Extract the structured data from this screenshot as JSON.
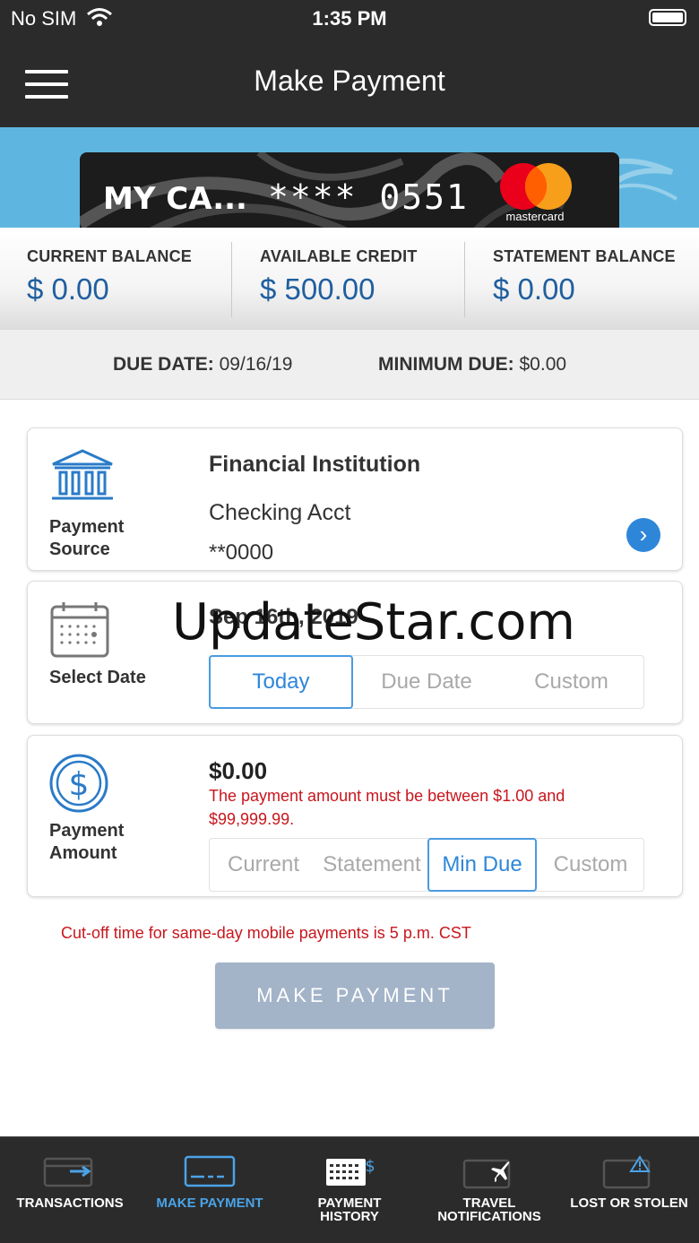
{
  "status_bar": {
    "carrier": "No SIM",
    "time": "1:35 PM",
    "battery_level": 1.0
  },
  "header": {
    "title": "Make Payment"
  },
  "card": {
    "name": "MY CA...",
    "masked_number": "**** 0551",
    "network": "mastercard",
    "brand_colors": {
      "red": "#eb001b",
      "orange": "#f79e1b"
    }
  },
  "balances": [
    {
      "label": "CURRENT BALANCE",
      "value": "$ 0.00"
    },
    {
      "label": "AVAILABLE CREDIT",
      "value": "$ 500.00"
    },
    {
      "label": "STATEMENT BALANCE",
      "value": "$ 0.00"
    }
  ],
  "due": {
    "due_date_label": "DUE DATE:",
    "due_date_value": "09/16/19",
    "min_due_label": "MINIMUM DUE:",
    "min_due_value": "$0.00"
  },
  "payment_source": {
    "label_line1": "Payment",
    "label_line2": "Source",
    "institution": "Financial Institution",
    "account": "Checking Acct",
    "account_mask": "**0000",
    "icon": "bank-icon",
    "chevron_icon": "chevron-right-icon"
  },
  "select_date": {
    "label": "Select Date",
    "date": "Sep 16th, 2019",
    "icon": "calendar-icon",
    "options": [
      "Today",
      "Due Date",
      "Custom"
    ],
    "selected": "Today"
  },
  "payment_amount": {
    "label_line1": "Payment",
    "label_line2": "Amount",
    "amount": "$0.00",
    "error": "The payment amount must be between $1.00 and $99,999.99.",
    "icon": "dollar-icon",
    "options": [
      "Current",
      "Statement",
      "Min Due",
      "Custom"
    ],
    "selected": "Min Due"
  },
  "cutoff_note": "Cut-off time for same-day mobile payments is 5 p.m. CST",
  "submit_label": "MAKE PAYMENT",
  "watermark": "UpdateStar.com",
  "tabs": [
    {
      "label": "TRANSACTIONS",
      "label2": "",
      "icon": "transactions-icon",
      "active": false
    },
    {
      "label": "MAKE PAYMENT",
      "label2": "",
      "icon": "card-payment-icon",
      "active": true
    },
    {
      "label": "PAYMENT",
      "label2": "HISTORY",
      "icon": "payment-history-icon",
      "active": false
    },
    {
      "label": "TRAVEL",
      "label2": "NOTIFICATIONS",
      "icon": "travel-plane-icon",
      "active": false
    },
    {
      "label": "LOST OR STOLEN",
      "label2": "",
      "icon": "warning-icon",
      "active": false
    }
  ],
  "colors": {
    "accent": "#2e86d9",
    "error": "#c8161d",
    "button_disabled": "#a3b3c8",
    "header_bg": "#2b2b2b",
    "banner_bg": "#5eb6e0"
  }
}
